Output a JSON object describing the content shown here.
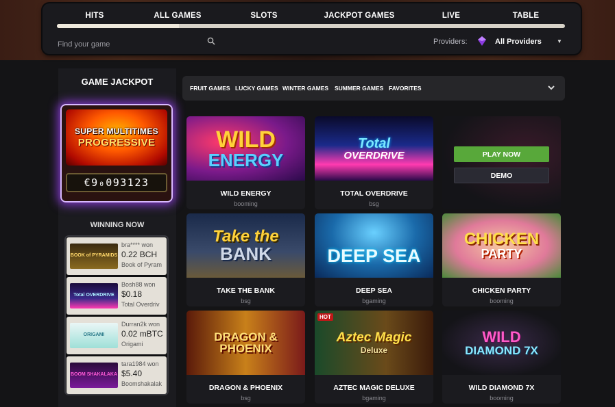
{
  "nav": {
    "items": [
      "HITS",
      "ALL GAMES",
      "SLOTS",
      "JACKPOT GAMES",
      "LIVE",
      "TABLE"
    ],
    "progress": 0.24
  },
  "search": {
    "placeholder": "Find your game"
  },
  "providers": {
    "label": "Providers:",
    "selected": "All Providers"
  },
  "sidebar": {
    "jackpot_title": "GAME JACKPOT",
    "jackpot_logo_line1": "SUPER MULTITIMES",
    "jackpot_logo_line2": "PROGRESSIVE",
    "jackpot_counter": "€9₀093123",
    "winning_title": "WINNING NOW",
    "winners": [
      {
        "name": "bra**** won",
        "amount": "0.22 BCH",
        "game": "Book of Pyram",
        "thumb_text": "BOOK of PYRAMIDS"
      },
      {
        "name": "Bosh88 won",
        "amount": "$0.18",
        "game": "Total Overdriv",
        "thumb_text": "Total OVERDRIVE"
      },
      {
        "name": "Durran2k won",
        "amount": "0.02 mBTC",
        "game": "Origami",
        "thumb_text": "ORIGAMI"
      },
      {
        "name": "tara1984 won",
        "amount": "$5.40",
        "game": "Boomshakalak",
        "thumb_text": "BOOM SHAKALAKA"
      }
    ]
  },
  "categories": [
    "FRUIT GAMES",
    "LUCKY GAMES",
    "WINTER GAMES",
    "SUMMER GAMES",
    "FAVORITES"
  ],
  "games": [
    {
      "title": "WILD ENERGY",
      "provider": "booming",
      "logo1": "WILD",
      "logo2": "ENERGY"
    },
    {
      "title": "TOTAL OVERDRIVE",
      "provider": "bsg",
      "logo1": "Total",
      "logo2": "OVERDRIVE"
    },
    {
      "title": "",
      "provider": "",
      "play_label": "PLAY NOW",
      "demo_label": "DEMO"
    },
    {
      "title": "TAKE THE BANK",
      "provider": "bsg",
      "logo1": "Take the",
      "logo2": "BANK"
    },
    {
      "title": "DEEP SEA",
      "provider": "bgaming",
      "logo1": "DEEP SEA",
      "logo2": ""
    },
    {
      "title": "CHICKEN PARTY",
      "provider": "booming",
      "logo1": "CHICKEN",
      "logo2": "PARTY"
    },
    {
      "title": "DRAGON & PHOENIX",
      "provider": "bsg",
      "logo1": "DRAGON &",
      "logo2": "PHOENIX"
    },
    {
      "title": "AZTEC MAGIC DELUXE",
      "provider": "bgaming",
      "logo1": "Aztec Magic",
      "logo2": "Deluxe",
      "badge": "HOT"
    },
    {
      "title": "WILD DIAMOND 7X",
      "provider": "booming",
      "logo1": "WILD",
      "logo2": "DIAMOND 7X"
    }
  ],
  "colors": {
    "accent_green": "#58a83a",
    "jackpot_glow": "#8c3cdc",
    "background": "#141416"
  }
}
